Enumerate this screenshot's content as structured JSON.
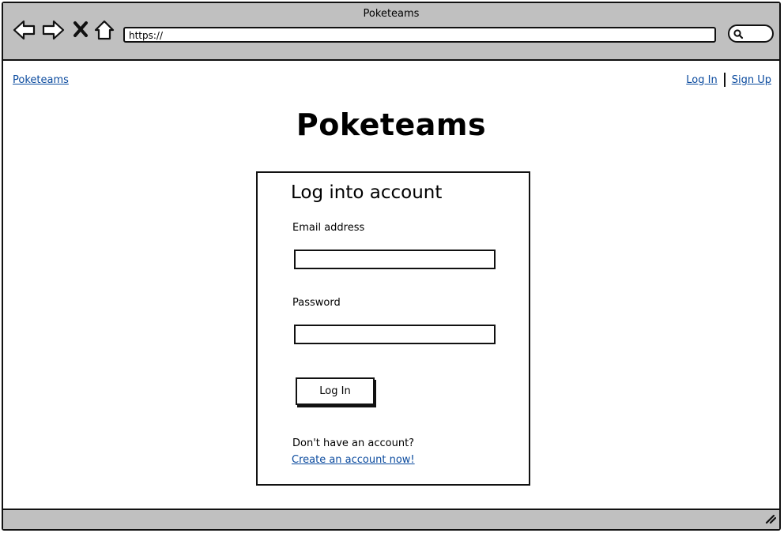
{
  "window": {
    "title": "Poketeams"
  },
  "browser": {
    "url": "https://",
    "icons": [
      "back-arrow-icon",
      "forward-arrow-icon",
      "close-icon",
      "home-icon",
      "search-icon"
    ]
  },
  "nav": {
    "site_link": "Poketeams",
    "login_link": "Log In",
    "signup_link": "Sign Up"
  },
  "hero": {
    "title": "Poketeams"
  },
  "login_card": {
    "title": "Log into account",
    "email_label": "Email address",
    "email_value": "",
    "password_label": "Password",
    "password_value": "",
    "submit_label": "Log In",
    "signup_prompt": "Don't have an account?",
    "signup_link": "Create an account now!"
  },
  "colors": {
    "chrome": "#c0c0c0",
    "link": "#0a4a9e",
    "border": "#111111"
  }
}
